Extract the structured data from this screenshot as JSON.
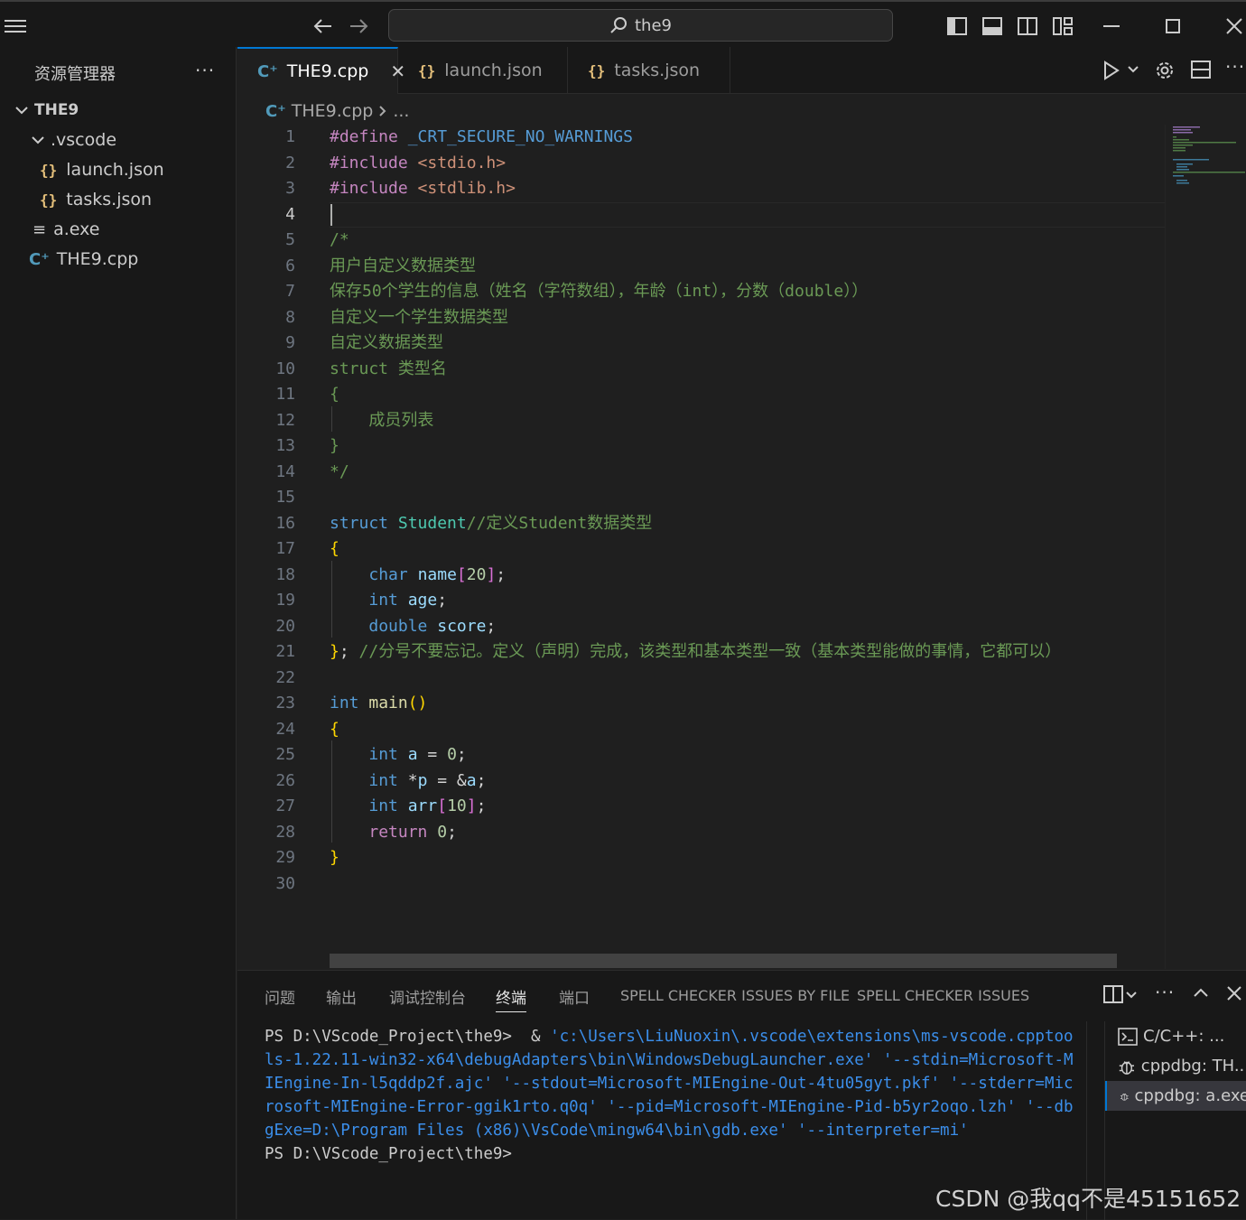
{
  "titlebar": {
    "search_text": "the9"
  },
  "sidebar": {
    "title": "资源管理器",
    "more": "···",
    "root": "THE9",
    "items": [
      {
        "label": ".vscode"
      },
      {
        "label": "launch.json"
      },
      {
        "label": "tasks.json"
      },
      {
        "label": "a.exe"
      },
      {
        "label": "THE9.cpp"
      }
    ]
  },
  "tabs": [
    {
      "label": "THE9.cpp",
      "active": true
    },
    {
      "label": "launch.json"
    },
    {
      "label": "tasks.json"
    }
  ],
  "breadcrumb": {
    "file": "THE9.cpp",
    "rest": "..."
  },
  "editor": {
    "current_line": 4,
    "line_numbers": [
      "1",
      "2",
      "3",
      "4",
      "5",
      "6",
      "7",
      "8",
      "9",
      "10",
      "11",
      "12",
      "13",
      "14",
      "15",
      "16",
      "17",
      "18",
      "19",
      "20",
      "21",
      "22",
      "23",
      "24",
      "25",
      "26",
      "27",
      "28",
      "29",
      "30"
    ],
    "code": {
      "l1_a": "#define",
      "l1_b": "_CRT_SECURE_NO_WARNINGS",
      "l2_a": "#include",
      "l2_b": "<stdio.h>",
      "l3_a": "#include",
      "l3_b": "<stdlib.h>",
      "l5": "/*",
      "l6": "用户自定义数据类型",
      "l7": "保存50个学生的信息（姓名（字符数组），年龄（int），分数（double））",
      "l8": "自定义一个学生数据类型",
      "l9": "自定义数据类型",
      "l10": "struct 类型名",
      "l11": "{",
      "l12": "    成员列表",
      "l13": "}",
      "l14": "*/",
      "l16_kw": "struct",
      "l16_name": "Student",
      "l16_cm": "//定义Student数据类型",
      "l17": "{",
      "l18_ty": "char",
      "l18_id": "name",
      "l18_n": "20",
      "l19_ty": "int",
      "l19_id": "age",
      "l20_ty": "double",
      "l20_id": "score",
      "l21_br": "}",
      "l21_cm": "//分号不要忘记。定义（声明）完成，该类型和基本类型一致（基本类型能做的事情，它都可以）",
      "l23_ty": "int",
      "l23_fn": "main",
      "l23_p": "()",
      "l24": "{",
      "l25_ty": "int",
      "l25_id": "a",
      "l25_n": "0",
      "l26_ty": "int",
      "l26_id": "p",
      "l26_ref": "a",
      "l27_ty": "int",
      "l27_id": "arr",
      "l27_n": "10",
      "l28_kw": "return",
      "l28_n": "0",
      "l29": "}"
    }
  },
  "panel": {
    "tabs": [
      "问题",
      "输出",
      "调试控制台",
      "终端",
      "端口",
      "SPELL CHECKER ISSUES BY FILE",
      "SPELL CHECKER ISSUES"
    ],
    "active_tab": "终端",
    "terminal": {
      "prompt1": "PS D:\\VScode_Project\\the9> ",
      "amp": " & ",
      "path": "'c:\\Users\\LiuNuoxin\\.vscode\\extensions\\ms-vscode.cpptools-1.22.11-win32-x64\\debugAdapters\\bin\\WindowsDebugLauncher.exe'",
      "args": " '--stdin=Microsoft-MIEngine-In-l5qddp2f.ajc' '--stdout=Microsoft-MIEngine-Out-4tu05gyt.pkf' '--stderr=Microsoft-MIEngine-Error-ggik1rto.q0q' '--pid=Microsoft-MIEngine-Pid-b5yr2oqo.lzh' '--dbgExe=D:\\Program Files (x86)\\VsCode\\mingw64\\bin\\gdb.exe' '--interpreter=mi'",
      "prompt2": "PS D:\\VScode_Project\\the9>"
    },
    "terminal_list": [
      "C/C++: ...",
      "cppdbg: TH...",
      "cppdbg: a.exe"
    ]
  },
  "watermark": "CSDN @我qq不是45151652",
  "colors": {
    "accent": "#0078d4",
    "keyword": "#569cd6",
    "comment": "#6a9955",
    "type": "#4ec9b0"
  }
}
